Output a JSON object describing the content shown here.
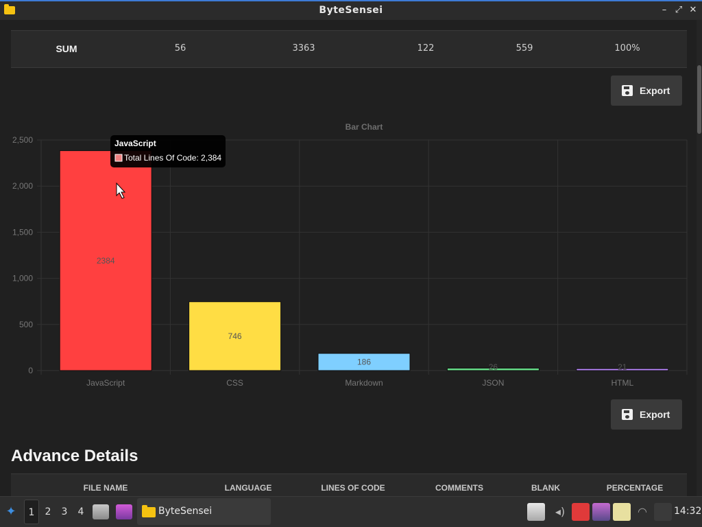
{
  "window": {
    "title": "ByteSensei",
    "controls": {
      "minimize": "–",
      "maximize": "⤢",
      "close": "✕"
    }
  },
  "summary_row": {
    "label": "SUM",
    "files": "56",
    "lines_of_code": "3363",
    "comments": "122",
    "blank": "559",
    "percentage": "100%"
  },
  "export_label": "Export",
  "chart_data": {
    "type": "bar",
    "title": "Bar Chart",
    "categories": [
      "JavaScript",
      "CSS",
      "Markdown",
      "JSON",
      "HTML"
    ],
    "values": [
      2384,
      746,
      186,
      26,
      21
    ],
    "colors": [
      "#ff4040",
      "#ffdd44",
      "#7fcfff",
      "#66dd88",
      "#bb88ff"
    ],
    "ylim": [
      0,
      2500
    ],
    "yticks": [
      0,
      500,
      1000,
      1500,
      2000,
      2500
    ],
    "ytick_labels": [
      "0",
      "500",
      "1,000",
      "1,500",
      "2,000",
      "2,500"
    ],
    "grid": true,
    "tooltip": {
      "title": "JavaScript",
      "text": "Total Lines Of Code: 2,384",
      "color": "#f08080"
    }
  },
  "advance_details": {
    "title": "Advance Details",
    "columns": [
      "FILE NAME",
      "LANGUAGE",
      "LINES OF CODE",
      "COMMENTS",
      "BLANK",
      "PERCENTAGE"
    ]
  },
  "taskbar": {
    "workspaces": [
      "1",
      "2",
      "3",
      "4"
    ],
    "active_workspace": "1",
    "task_label": "ByteSensei",
    "clock": "14:32"
  }
}
